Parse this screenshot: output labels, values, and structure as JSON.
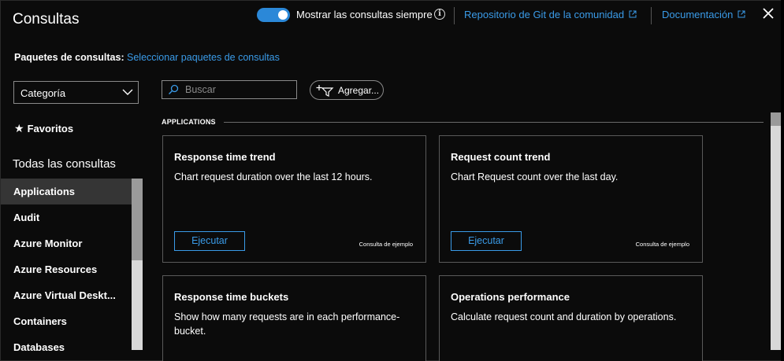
{
  "header": {
    "title": "Consultas",
    "toggle_label": "Mostrar las consultas siempre",
    "toggle_on": true,
    "community_link": "Repositorio de Git de la comunidad",
    "docs_link": "Documentación"
  },
  "packages": {
    "label": "Paquetes de consultas:",
    "link": "Seleccionar paquetes de consultas"
  },
  "filters": {
    "category_label": "Categoría",
    "search_placeholder": "Buscar",
    "add_label": "Agregar..."
  },
  "sidebar": {
    "favorites": "Favoritos",
    "all_queries": "Todas las consultas",
    "items": [
      {
        "label": "Applications",
        "active": true
      },
      {
        "label": "Audit"
      },
      {
        "label": "Azure Monitor"
      },
      {
        "label": "Azure Resources"
      },
      {
        "label": "Azure Virtual Deskt..."
      },
      {
        "label": "Containers"
      },
      {
        "label": "Databases"
      }
    ]
  },
  "main": {
    "section": "APPLICATIONS",
    "cards": [
      {
        "title": "Response time trend",
        "description": "Chart request duration over the last 12 hours.",
        "run": "Ejecutar",
        "tag": "Consulta de ejemplo"
      },
      {
        "title": "Request count trend",
        "description": "Chart Request count over the last day.",
        "run": "Ejecutar",
        "tag": "Consulta de ejemplo"
      },
      {
        "title": "Response time buckets",
        "description": "Show how many requests are in each performance-bucket."
      },
      {
        "title": "Operations performance",
        "description": "Calculate request count and duration by operations."
      }
    ]
  },
  "colors": {
    "accent": "#3a9be8",
    "toggle": "#2b88d8",
    "background": "#0b0b0b",
    "active_item": "#353535"
  }
}
